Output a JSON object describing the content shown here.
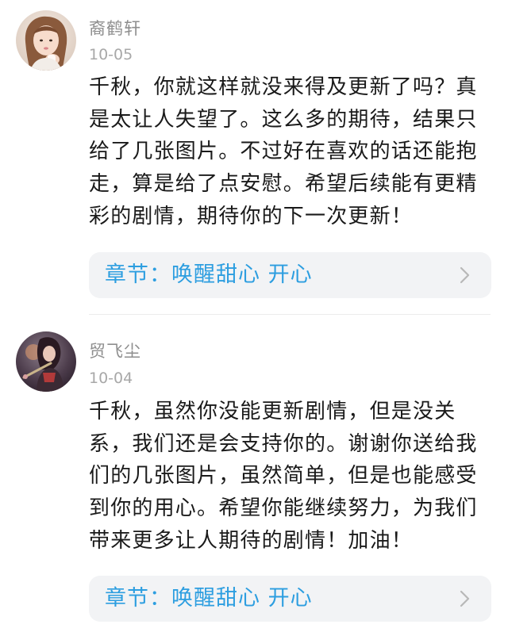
{
  "comments": [
    {
      "username": "裔鹤轩",
      "date": "10-05",
      "text": "千秋，你就这样就没来得及更新了吗？真是太让人失望了。这么多的期待，结果只给了几张图片。不过好在喜欢的话还能抱走，算是给了点安慰。希望后续能有更精彩的剧情，期待你的下一次更新！",
      "chapter": "章节：唤醒甜心 开心",
      "avatar_icon": "avatar-girl-photo"
    },
    {
      "username": "贸飞尘",
      "date": "10-04",
      "text": "千秋，虽然你没能更新剧情，但是没关系，我们还是会支持你的。谢谢你送给我们的几张图片，虽然简单，但是也能感受到你的用心。希望你能继续努力，为我们带来更多让人期待的剧情！加油！",
      "chapter": "章节：唤醒甜心 开心",
      "avatar_icon": "avatar-game-character"
    }
  ],
  "colors": {
    "chapter_text": "#2d9ee0",
    "card_bg": "#f2f3f5",
    "meta_text": "#8e8e8e",
    "body_text": "#1a1a1a"
  }
}
